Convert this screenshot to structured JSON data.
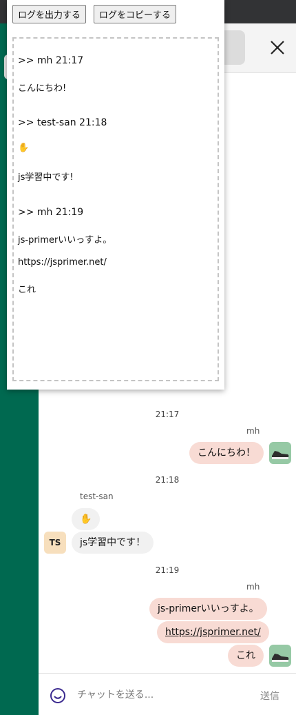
{
  "popup": {
    "export_button": "ログを出力する",
    "copy_button": "ログをコピーする",
    "log": [
      {
        "type": "header",
        "text": ">> mh 21:17"
      },
      {
        "type": "msg",
        "text": "こんにちわ!"
      },
      {
        "type": "header",
        "text": ">> test-san 21:18"
      },
      {
        "type": "msg",
        "text": "✋"
      },
      {
        "type": "msg",
        "text": "js学習中です!"
      },
      {
        "type": "header",
        "text": ">> mh 21:19"
      },
      {
        "type": "msg",
        "text": "js-primerいいっすよ。"
      },
      {
        "type": "msg",
        "text": "https://jsprimer.net/"
      },
      {
        "type": "msg",
        "text": "これ"
      }
    ]
  },
  "chat": {
    "groups": [
      {
        "time": "21:17",
        "sender": "mh",
        "messages": [
          "こんにちわ！"
        ]
      },
      {
        "time": "21:18",
        "sender": "test-san",
        "avatar": "TS",
        "messages": [
          "✋",
          "js学習中です！"
        ]
      },
      {
        "time": "21:19",
        "sender": "mh",
        "messages": [
          "js-primerいいっすよ。",
          "https://jsprimer.net/",
          "これ"
        ]
      }
    ]
  },
  "input": {
    "placeholder": "チャットを送る...",
    "send_label": "送信"
  },
  "icons": {
    "close": "close-icon",
    "emoji": "smiley-icon",
    "avatar": "shoe-avatar-icon"
  },
  "colors": {
    "sidebar": "#006950",
    "my_bubble": "#f8dbd4",
    "their_bubble": "#f1f1f1",
    "ts_avatar": "#f7dfbd"
  }
}
